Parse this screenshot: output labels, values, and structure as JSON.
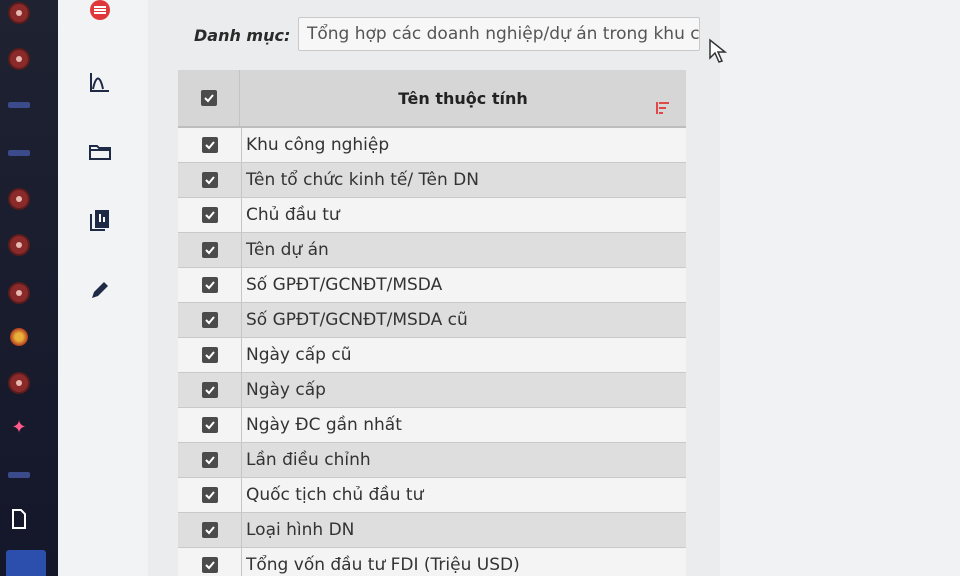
{
  "category": {
    "label": "Danh mục:",
    "value": "Tổng hợp các doanh nghiệp/dự án trong khu công"
  },
  "table": {
    "header": "Tên thuộc tính",
    "rows": [
      "Khu công nghiệp",
      "Tên tổ chức kinh tế/ Tên DN",
      "Chủ đầu tư",
      "Tên dự án",
      "Số GPĐT/GCNĐT/MSDA",
      "Số GPĐT/GCNĐT/MSDA cũ",
      "Ngày cấp cũ",
      "Ngày cấp",
      "Ngày ĐC gần nhất",
      "Lần điều chỉnh",
      "Quốc tịch chủ đầu tư",
      "Loại hình DN",
      "Tổng vốn đầu tư FDI (Triệu USD)"
    ],
    "all_checked": true
  },
  "icons": {
    "sidebar": [
      "menu-icon",
      "chart-icon",
      "folder-icon",
      "report-icon",
      "edit-icon"
    ],
    "taskbar": [
      "app-icon",
      "app-icon",
      "app-icon",
      "app-icon",
      "app-icon",
      "app-icon",
      "emblem-icon",
      "sparkle-icon",
      "document-icon"
    ]
  },
  "colors": {
    "menu_icon": "#e0383a",
    "sidebar_icon": "#1f2a44",
    "sort_icon": "#e04848"
  }
}
